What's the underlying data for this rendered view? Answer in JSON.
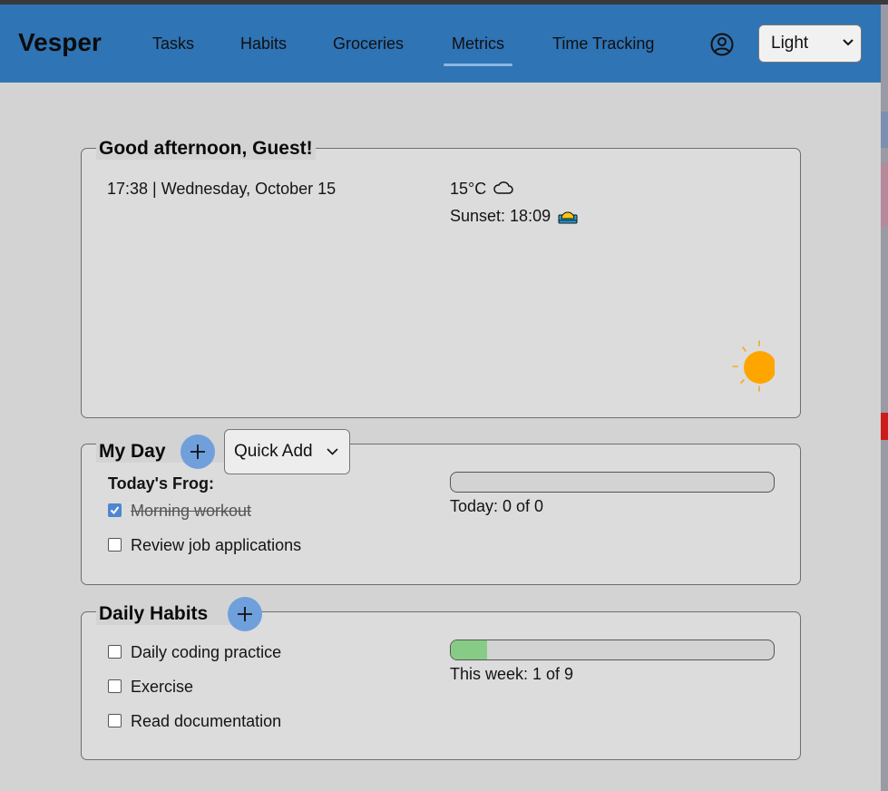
{
  "app": {
    "brand": "Vesper"
  },
  "nav": {
    "items": [
      {
        "label": "Tasks"
      },
      {
        "label": "Habits"
      },
      {
        "label": "Groceries"
      },
      {
        "label": "Metrics",
        "active": true
      },
      {
        "label": "Time Tracking"
      }
    ],
    "user_icon": "user-circle-icon",
    "theme": {
      "selected": "Light"
    }
  },
  "greeting": {
    "title": "Good afternoon, Guest!",
    "datetime": "17:38 | Wednesday, October 15",
    "temperature": "15°C",
    "weather_icon": "cloud-icon",
    "sunset": "Sunset: 18:09",
    "sunset_icon": "sunset-icon",
    "decor_icon": "sun-icon"
  },
  "my_day": {
    "title": "My Day",
    "quick_add_label": "Quick Add",
    "frog_label": "Today's Frog:",
    "tasks": [
      {
        "label": "Morning workout",
        "done": true
      },
      {
        "label": "Review job applications",
        "done": false
      }
    ],
    "progress_text": "Today: 0 of 0",
    "progress_fraction": 0
  },
  "habits": {
    "title": "Daily Habits",
    "items": [
      {
        "label": "Daily coding practice",
        "done": false
      },
      {
        "label": "Exercise",
        "done": false
      },
      {
        "label": "Read documentation",
        "done": false
      }
    ],
    "progress_text": "This week: 1 of 9",
    "progress_fraction": 0.111
  },
  "colors": {
    "navbar": "#2f74b5",
    "accent": "#6fa0dc",
    "progress_fill": "#86cc86",
    "sun": "#ffa500"
  }
}
